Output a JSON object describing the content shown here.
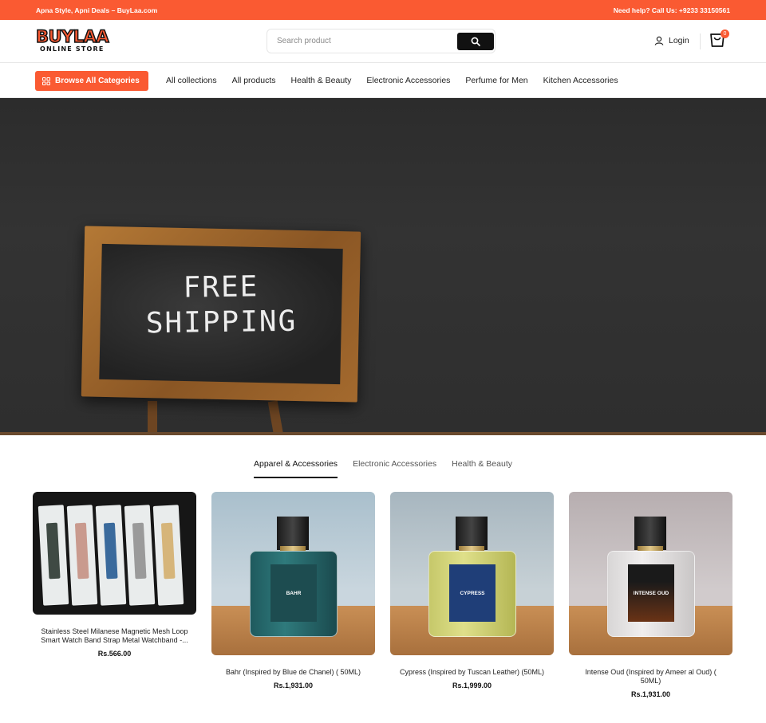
{
  "topbar": {
    "left_text": "Apna Style, Apni Deals – BuyLaa.com",
    "right_text": "Need help? Call Us: +9233 33150561"
  },
  "header": {
    "logo_main": "BUYLAA",
    "logo_sub": "ONLINE STORE",
    "search_placeholder": "Search product",
    "login_label": "Login",
    "cart_count": "0"
  },
  "nav": {
    "browse_label": "Browse All Categories",
    "links": [
      "All collections",
      "All products",
      "Health & Beauty",
      "Electronic Accessories",
      "Perfume for Men",
      "Kitchen Accessories"
    ]
  },
  "hero": {
    "board_line1": "FREE",
    "board_line2": "SHIPPING"
  },
  "tabs": [
    "Apparel & Accessories",
    "Electronic Accessories",
    "Health & Beauty"
  ],
  "products": [
    {
      "title": "Stainless Steel Milanese Magnetic Mesh Loop Smart Watch Band Strap Metal Watchband -...",
      "price": "Rs.566.00"
    },
    {
      "title": "Bahr (Inspired by Blue de Chanel) ( 50ML)",
      "price": "Rs.1,931.00",
      "label": "BAHR"
    },
    {
      "title": "Cypress (Inspired by Tuscan Leather) (50ML)",
      "price": "Rs.1,999.00",
      "label": "CYPRESS"
    },
    {
      "title": "Intense Oud (Inspired by Ameer al Oud) ( 50ML)",
      "price": "Rs.1,931.00",
      "label": "INTENSE OUD"
    }
  ],
  "colors": {
    "accent": "#fa5a32",
    "dark": "#111111"
  }
}
